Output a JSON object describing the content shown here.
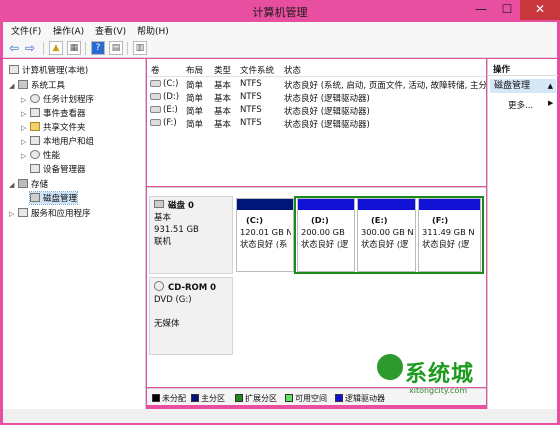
{
  "window": {
    "title": "计算机管理",
    "minimize": "—",
    "maximize": "☐",
    "close": "✕"
  },
  "menu": [
    "文件(F)",
    "操作(A)",
    "查看(V)",
    "帮助(H)"
  ],
  "toolbar": {
    "back": "⇦",
    "forward": "⇨",
    "up": "▲",
    "props": "▦",
    "help": "?",
    "view": "▤",
    "export": "▥"
  },
  "tree": [
    {
      "label": "计算机管理(本地)",
      "level": 0,
      "exp": "",
      "icon": "computer-icon"
    },
    {
      "label": "系统工具",
      "level": 1,
      "exp": "◢",
      "icon": "tools-icon"
    },
    {
      "label": "任务计划程序",
      "level": 2,
      "exp": "▷",
      "icon": "clock-icon"
    },
    {
      "label": "事件查看器",
      "level": 2,
      "exp": "▷",
      "icon": "event-log-icon"
    },
    {
      "label": "共享文件夹",
      "level": 2,
      "exp": "▷",
      "icon": "folder-icon"
    },
    {
      "label": "本地用户和组",
      "level": 2,
      "exp": "▷",
      "icon": "users-icon"
    },
    {
      "label": "性能",
      "level": 2,
      "exp": "▷",
      "icon": "performance-icon"
    },
    {
      "label": "设备管理器",
      "level": 2,
      "exp": "",
      "icon": "device-icon"
    },
    {
      "label": "存储",
      "level": 1,
      "exp": "◢",
      "icon": "storage-icon"
    },
    {
      "label": "磁盘管理",
      "level": 2,
      "exp": "",
      "icon": "disk-icon",
      "selected": true
    },
    {
      "label": "服务和应用程序",
      "level": 1,
      "exp": "▷",
      "icon": "services-icon"
    }
  ],
  "volume_table": {
    "headers": [
      "卷",
      "布局",
      "类型",
      "文件系统",
      "状态"
    ],
    "rows": [
      [
        "(C:)",
        "简单",
        "基本",
        "NTFS",
        "状态良好 (系统, 启动, 页面文件, 活动, 故障转储, 主分"
      ],
      [
        "(D:)",
        "简单",
        "基本",
        "NTFS",
        "状态良好 (逻辑驱动器)"
      ],
      [
        "(E:)",
        "简单",
        "基本",
        "NTFS",
        "状态良好 (逻辑驱动器)"
      ],
      [
        "(F:)",
        "简单",
        "基本",
        "NTFS",
        "状态良好 (逻辑驱动器)"
      ]
    ]
  },
  "disk0": {
    "name": "磁盘 0",
    "type": "基本",
    "size": "931.51 GB",
    "state": "联机",
    "partitions": [
      {
        "label": "(C:)",
        "size": "120.01 GB N",
        "status": "状态良好 (系",
        "bar_color": "#00157a"
      },
      {
        "label": "(D:)",
        "size": "200.00 GB",
        "status": "状态良好 (逻",
        "bar_color": "#1212d6"
      },
      {
        "label": "(E:)",
        "size": "300.00 GB N",
        "status": "状态良好 (逻",
        "bar_color": "#1212d6"
      },
      {
        "label": "(F:)",
        "size": "311.49 GB N",
        "status": "状态良好 (逻",
        "bar_color": "#1212d6"
      }
    ]
  },
  "cdrom0": {
    "name": "CD-ROM 0",
    "type": "DVD (G:)",
    "media": "无媒体"
  },
  "legend": [
    {
      "label": "未分配",
      "color": "#000000"
    },
    {
      "label": "主分区",
      "color": "#00157a"
    },
    {
      "label": "扩展分区",
      "color": "#1b8a1b"
    },
    {
      "label": "可用空间",
      "color": "#5ee45e"
    },
    {
      "label": "逻辑驱动器",
      "color": "#1212d6"
    }
  ],
  "actions": {
    "header": "操作",
    "selected": "磁盘管理",
    "more": "更多..."
  },
  "watermark": {
    "text": "系统城",
    "url": "xitongcity.com"
  },
  "colors": {
    "title_bg": "#e94fa0",
    "close_bg": "#c8373d",
    "extended_border": "#1b8a1b"
  }
}
